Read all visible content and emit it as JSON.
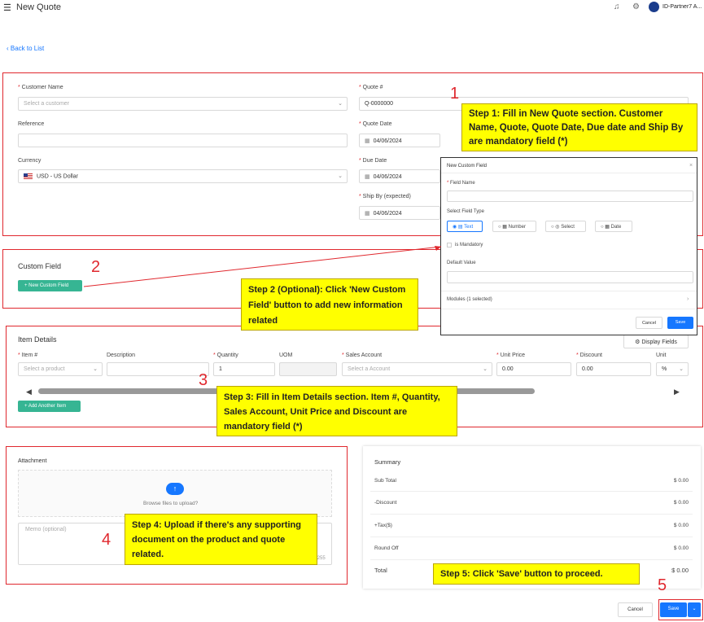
{
  "header": {
    "title": "New Quote",
    "user": "ID-Partner7 A..."
  },
  "nav": {
    "back": "Back to List"
  },
  "quote_form": {
    "customer_label": "Customer Name",
    "customer_placeholder": "Select a customer",
    "reference_label": "Reference",
    "currency_label": "Currency",
    "currency_value": "USD - US Dollar",
    "quote_no_label": "Quote #",
    "quote_no_value": "Q-0000000",
    "quote_date_label": "Quote Date",
    "quote_date_value": "04/06/2024",
    "due_date_label": "Due Date",
    "due_date_value": "04/06/2024",
    "ship_by_label": "Ship By (expected)",
    "ship_by_value": "04/06/2024"
  },
  "custom_field": {
    "title": "Custom Field",
    "button": "+ New Custom Field"
  },
  "modal": {
    "title": "New Custom Field",
    "field_name_label": "Field Name",
    "type_label": "Select Field Type",
    "types": [
      "Text",
      "Number",
      "Select",
      "Date"
    ],
    "mandatory_label": "is Mandatory",
    "default_label": "Default Value",
    "modules": "Modules (1 selected)",
    "cancel": "Cancel",
    "save": "Save"
  },
  "items": {
    "title": "Item Details",
    "display_fields": "Display Fields",
    "col_item": "Item #",
    "col_desc": "Description",
    "col_qty": "Quantity",
    "col_uom": "UOM",
    "col_account": "Sales Account",
    "col_price": "Unit Price",
    "col_discount": "Discount",
    "col_unit": "Unit",
    "item_placeholder": "Select a product",
    "qty_value": "1",
    "account_placeholder": "Select a Account",
    "price_value": "0.00",
    "discount_value": "0.00",
    "unit_value": "%",
    "add_button": "+ Add Another Item"
  },
  "attachment": {
    "title": "Attachment",
    "browse": "Browse files to upload?",
    "memo_placeholder": "Memo (optional)",
    "counter": "/255"
  },
  "summary": {
    "title": "Summary",
    "rows": [
      {
        "label": "Sub Total",
        "value": "$ 0.00"
      },
      {
        "label": "-Discount",
        "value": "$ 0.00"
      },
      {
        "label": "+Tax($)",
        "value": "$ 0.00"
      },
      {
        "label": "Round Off",
        "value": "$ 0.00"
      },
      {
        "label": "Total",
        "value": "$ 0.00"
      }
    ]
  },
  "footer": {
    "cancel": "Cancel",
    "save": "Save"
  },
  "callouts": {
    "step1": "Step 1: Fill in New Quote section. Customer Name, Quote, Quote Date, Due date and Ship By are mandatory field (*)",
    "step2": "Step 2 (Optional): Click 'New Custom Field' button to add new information related",
    "step3": "Step 3: Fill in Item Details section. Item #, Quantity, Sales Account, Unit Price and Discount are mandatory field (*)",
    "step4": "Step 4: Upload if there's any supporting document on the product and quote related.",
    "step5": "Step 5: Click 'Save' button to proceed.",
    "n1": "1",
    "n2": "2",
    "n3": "3",
    "n4": "4",
    "n5": "5"
  },
  "colors": {
    "accent": "#1677ff",
    "green": "#36b593",
    "annotation": "#e0282e",
    "highlight": "#ffff00"
  }
}
